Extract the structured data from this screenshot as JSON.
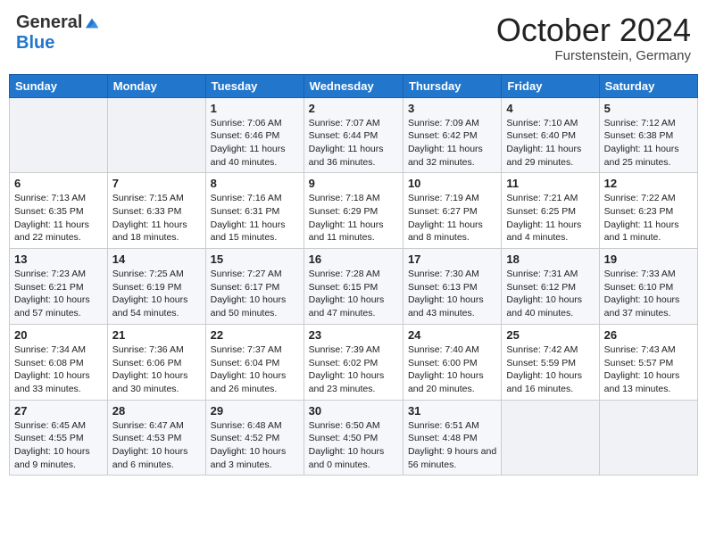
{
  "header": {
    "logo_general": "General",
    "logo_blue": "Blue",
    "month_title": "October 2024",
    "subtitle": "Furstenstein, Germany"
  },
  "days_of_week": [
    "Sunday",
    "Monday",
    "Tuesday",
    "Wednesday",
    "Thursday",
    "Friday",
    "Saturday"
  ],
  "weeks": [
    [
      {
        "day": "",
        "sunrise": "",
        "sunset": "",
        "daylight": ""
      },
      {
        "day": "",
        "sunrise": "",
        "sunset": "",
        "daylight": ""
      },
      {
        "day": "1",
        "sunrise": "Sunrise: 7:06 AM",
        "sunset": "Sunset: 6:46 PM",
        "daylight": "Daylight: 11 hours and 40 minutes."
      },
      {
        "day": "2",
        "sunrise": "Sunrise: 7:07 AM",
        "sunset": "Sunset: 6:44 PM",
        "daylight": "Daylight: 11 hours and 36 minutes."
      },
      {
        "day": "3",
        "sunrise": "Sunrise: 7:09 AM",
        "sunset": "Sunset: 6:42 PM",
        "daylight": "Daylight: 11 hours and 32 minutes."
      },
      {
        "day": "4",
        "sunrise": "Sunrise: 7:10 AM",
        "sunset": "Sunset: 6:40 PM",
        "daylight": "Daylight: 11 hours and 29 minutes."
      },
      {
        "day": "5",
        "sunrise": "Sunrise: 7:12 AM",
        "sunset": "Sunset: 6:38 PM",
        "daylight": "Daylight: 11 hours and 25 minutes."
      }
    ],
    [
      {
        "day": "6",
        "sunrise": "Sunrise: 7:13 AM",
        "sunset": "Sunset: 6:35 PM",
        "daylight": "Daylight: 11 hours and 22 minutes."
      },
      {
        "day": "7",
        "sunrise": "Sunrise: 7:15 AM",
        "sunset": "Sunset: 6:33 PM",
        "daylight": "Daylight: 11 hours and 18 minutes."
      },
      {
        "day": "8",
        "sunrise": "Sunrise: 7:16 AM",
        "sunset": "Sunset: 6:31 PM",
        "daylight": "Daylight: 11 hours and 15 minutes."
      },
      {
        "day": "9",
        "sunrise": "Sunrise: 7:18 AM",
        "sunset": "Sunset: 6:29 PM",
        "daylight": "Daylight: 11 hours and 11 minutes."
      },
      {
        "day": "10",
        "sunrise": "Sunrise: 7:19 AM",
        "sunset": "Sunset: 6:27 PM",
        "daylight": "Daylight: 11 hours and 8 minutes."
      },
      {
        "day": "11",
        "sunrise": "Sunrise: 7:21 AM",
        "sunset": "Sunset: 6:25 PM",
        "daylight": "Daylight: 11 hours and 4 minutes."
      },
      {
        "day": "12",
        "sunrise": "Sunrise: 7:22 AM",
        "sunset": "Sunset: 6:23 PM",
        "daylight": "Daylight: 11 hours and 1 minute."
      }
    ],
    [
      {
        "day": "13",
        "sunrise": "Sunrise: 7:23 AM",
        "sunset": "Sunset: 6:21 PM",
        "daylight": "Daylight: 10 hours and 57 minutes."
      },
      {
        "day": "14",
        "sunrise": "Sunrise: 7:25 AM",
        "sunset": "Sunset: 6:19 PM",
        "daylight": "Daylight: 10 hours and 54 minutes."
      },
      {
        "day": "15",
        "sunrise": "Sunrise: 7:27 AM",
        "sunset": "Sunset: 6:17 PM",
        "daylight": "Daylight: 10 hours and 50 minutes."
      },
      {
        "day": "16",
        "sunrise": "Sunrise: 7:28 AM",
        "sunset": "Sunset: 6:15 PM",
        "daylight": "Daylight: 10 hours and 47 minutes."
      },
      {
        "day": "17",
        "sunrise": "Sunrise: 7:30 AM",
        "sunset": "Sunset: 6:13 PM",
        "daylight": "Daylight: 10 hours and 43 minutes."
      },
      {
        "day": "18",
        "sunrise": "Sunrise: 7:31 AM",
        "sunset": "Sunset: 6:12 PM",
        "daylight": "Daylight: 10 hours and 40 minutes."
      },
      {
        "day": "19",
        "sunrise": "Sunrise: 7:33 AM",
        "sunset": "Sunset: 6:10 PM",
        "daylight": "Daylight: 10 hours and 37 minutes."
      }
    ],
    [
      {
        "day": "20",
        "sunrise": "Sunrise: 7:34 AM",
        "sunset": "Sunset: 6:08 PM",
        "daylight": "Daylight: 10 hours and 33 minutes."
      },
      {
        "day": "21",
        "sunrise": "Sunrise: 7:36 AM",
        "sunset": "Sunset: 6:06 PM",
        "daylight": "Daylight: 10 hours and 30 minutes."
      },
      {
        "day": "22",
        "sunrise": "Sunrise: 7:37 AM",
        "sunset": "Sunset: 6:04 PM",
        "daylight": "Daylight: 10 hours and 26 minutes."
      },
      {
        "day": "23",
        "sunrise": "Sunrise: 7:39 AM",
        "sunset": "Sunset: 6:02 PM",
        "daylight": "Daylight: 10 hours and 23 minutes."
      },
      {
        "day": "24",
        "sunrise": "Sunrise: 7:40 AM",
        "sunset": "Sunset: 6:00 PM",
        "daylight": "Daylight: 10 hours and 20 minutes."
      },
      {
        "day": "25",
        "sunrise": "Sunrise: 7:42 AM",
        "sunset": "Sunset: 5:59 PM",
        "daylight": "Daylight: 10 hours and 16 minutes."
      },
      {
        "day": "26",
        "sunrise": "Sunrise: 7:43 AM",
        "sunset": "Sunset: 5:57 PM",
        "daylight": "Daylight: 10 hours and 13 minutes."
      }
    ],
    [
      {
        "day": "27",
        "sunrise": "Sunrise: 6:45 AM",
        "sunset": "Sunset: 4:55 PM",
        "daylight": "Daylight: 10 hours and 9 minutes."
      },
      {
        "day": "28",
        "sunrise": "Sunrise: 6:47 AM",
        "sunset": "Sunset: 4:53 PM",
        "daylight": "Daylight: 10 hours and 6 minutes."
      },
      {
        "day": "29",
        "sunrise": "Sunrise: 6:48 AM",
        "sunset": "Sunset: 4:52 PM",
        "daylight": "Daylight: 10 hours and 3 minutes."
      },
      {
        "day": "30",
        "sunrise": "Sunrise: 6:50 AM",
        "sunset": "Sunset: 4:50 PM",
        "daylight": "Daylight: 10 hours and 0 minutes."
      },
      {
        "day": "31",
        "sunrise": "Sunrise: 6:51 AM",
        "sunset": "Sunset: 4:48 PM",
        "daylight": "Daylight: 9 hours and 56 minutes."
      },
      {
        "day": "",
        "sunrise": "",
        "sunset": "",
        "daylight": ""
      },
      {
        "day": "",
        "sunrise": "",
        "sunset": "",
        "daylight": ""
      }
    ]
  ]
}
